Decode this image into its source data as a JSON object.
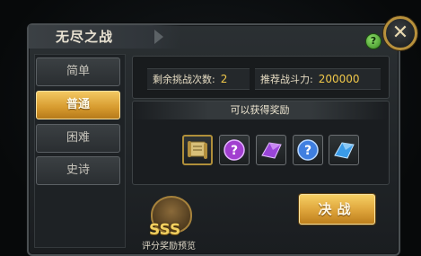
{
  "dialog": {
    "title": "无尽之战",
    "help_icon": "question-circle-icon",
    "close_icon": "close-x-icon"
  },
  "tabs": [
    {
      "label": "简单",
      "active": false
    },
    {
      "label": "普通",
      "active": true
    },
    {
      "label": "困难",
      "active": false
    },
    {
      "label": "史诗",
      "active": false
    }
  ],
  "stats": {
    "remaining_label": "剩余挑战次数:",
    "remaining_value": "2",
    "power_label": "推荐战斗力:",
    "power_value": "200000"
  },
  "rewards": {
    "heading": "可以获得奖励",
    "items": [
      {
        "icon": "scroll-icon",
        "color": "#c8a64a"
      },
      {
        "icon": "purple-mystery-orb-icon",
        "color": "#a23fd0"
      },
      {
        "icon": "purple-crystal-shard-icon",
        "color": "#9a45d8"
      },
      {
        "icon": "blue-mystery-orb-icon",
        "color": "#3f7fe0"
      },
      {
        "icon": "blue-crystal-shard-icon",
        "color": "#3a9be8"
      }
    ]
  },
  "grade": {
    "rank": "SSS",
    "caption": "评分奖励预览"
  },
  "action": {
    "fight_label": "决战"
  },
  "colors": {
    "accent_gold": "#f0c84a",
    "button_gold": "#dda33a"
  }
}
